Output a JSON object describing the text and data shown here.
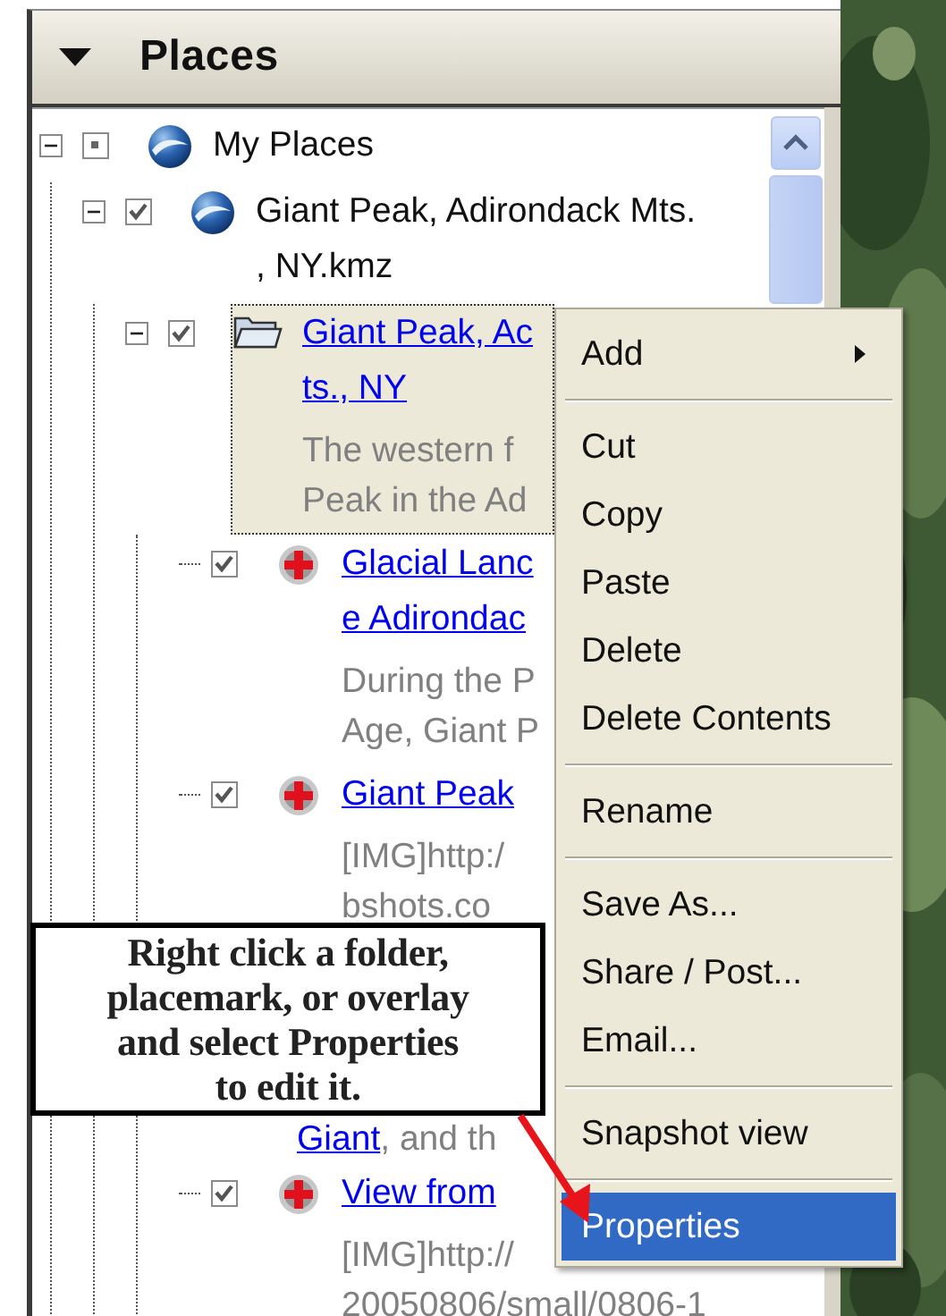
{
  "places": {
    "title": "Places",
    "expanded": true,
    "tree": [
      {
        "kind": "globe",
        "label": [
          "My Places"
        ],
        "checked": false,
        "mixed": true,
        "expanded": true,
        "children": [
          {
            "kind": "globe",
            "label": [
              "Giant Peak, Adirondack Mts.",
              ", NY.kmz"
            ],
            "checked": true,
            "mixed": false,
            "expanded": true,
            "children": [
              {
                "kind": "folder",
                "link": [
                  "Giant Peak, Ac",
                  "ts., NY"
                ],
                "description": [
                  "The western f",
                  "Peak in the Ad"
                ],
                "checked": true,
                "mixed": false,
                "selected": true,
                "expanded": true,
                "children": [
                  {
                    "kind": "placemark",
                    "link": [
                      "Glacial Lanc",
                      "e Adirondac"
                    ],
                    "description": [
                      "During the P",
                      "Age, Giant P"
                    ],
                    "checked": true,
                    "mixed": false,
                    "selected": false
                  },
                  {
                    "kind": "placemark",
                    "link": [
                      "Giant Peak"
                    ],
                    "description": [
                      "[IMG]http:/",
                      "bshots.co"
                    ],
                    "checked": true,
                    "mixed": false,
                    "selected": false
                  },
                  {
                    "kind": "obscured",
                    "description_line": {
                      "link": "Giant",
                      "text": ", and th"
                    }
                  },
                  {
                    "kind": "placemark",
                    "link": [
                      "View from"
                    ],
                    "description": [
                      "[IMG]http://",
                      "20050806/small/0806-1"
                    ],
                    "checked": true,
                    "mixed": false,
                    "selected": false
                  }
                ]
              }
            ]
          }
        ]
      }
    ]
  },
  "context_menu": {
    "items": [
      {
        "kind": "item",
        "label": "Add",
        "submenu": true,
        "selected": false
      },
      {
        "kind": "separator"
      },
      {
        "kind": "item",
        "label": "Cut",
        "submenu": false,
        "selected": false
      },
      {
        "kind": "item",
        "label": "Copy",
        "submenu": false,
        "selected": false
      },
      {
        "kind": "item",
        "label": "Paste",
        "submenu": false,
        "selected": false
      },
      {
        "kind": "item",
        "label": "Delete",
        "submenu": false,
        "selected": false
      },
      {
        "kind": "item",
        "label": "Delete Contents",
        "submenu": false,
        "selected": false
      },
      {
        "kind": "separator"
      },
      {
        "kind": "item",
        "label": "Rename",
        "submenu": false,
        "selected": false
      },
      {
        "kind": "separator"
      },
      {
        "kind": "item",
        "label": "Save As...",
        "submenu": false,
        "selected": false
      },
      {
        "kind": "item",
        "label": "Share / Post...",
        "submenu": false,
        "selected": false
      },
      {
        "kind": "item",
        "label": "Email...",
        "submenu": false,
        "selected": false
      },
      {
        "kind": "separator"
      },
      {
        "kind": "item",
        "label": "Snapshot view",
        "submenu": false,
        "selected": false
      },
      {
        "kind": "separator"
      },
      {
        "kind": "item",
        "label": "Properties",
        "submenu": false,
        "selected": true
      }
    ]
  },
  "callout": {
    "lines": [
      "Right click a folder,",
      "placemark, or overlay",
      "and select Properties",
      "to edit it."
    ]
  }
}
